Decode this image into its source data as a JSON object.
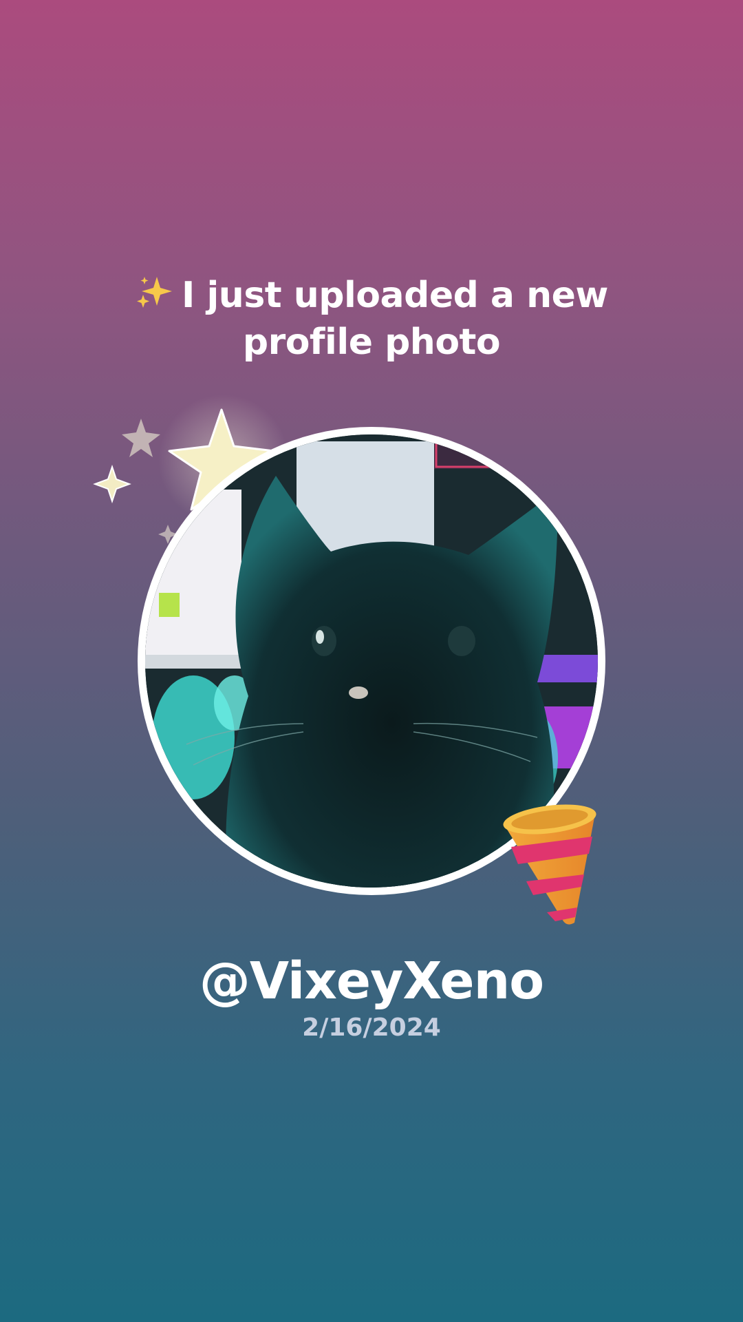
{
  "announcement": {
    "line1": "I just uploaded a new",
    "line2": "profile photo",
    "sparkle_icon": "sparkles-icon"
  },
  "profile": {
    "username": "@VixeyXeno",
    "date": "2/16/2024",
    "avatar_description_icon": "profile-photo"
  },
  "decorations": {
    "stars_icon": "star-icon",
    "party_icon": "party-popper-icon"
  },
  "colors": {
    "gradient_top": "#ab4b7e",
    "gradient_bottom": "#1c6a80",
    "text": "#ffffff",
    "date_text": "#c6cfe0"
  }
}
